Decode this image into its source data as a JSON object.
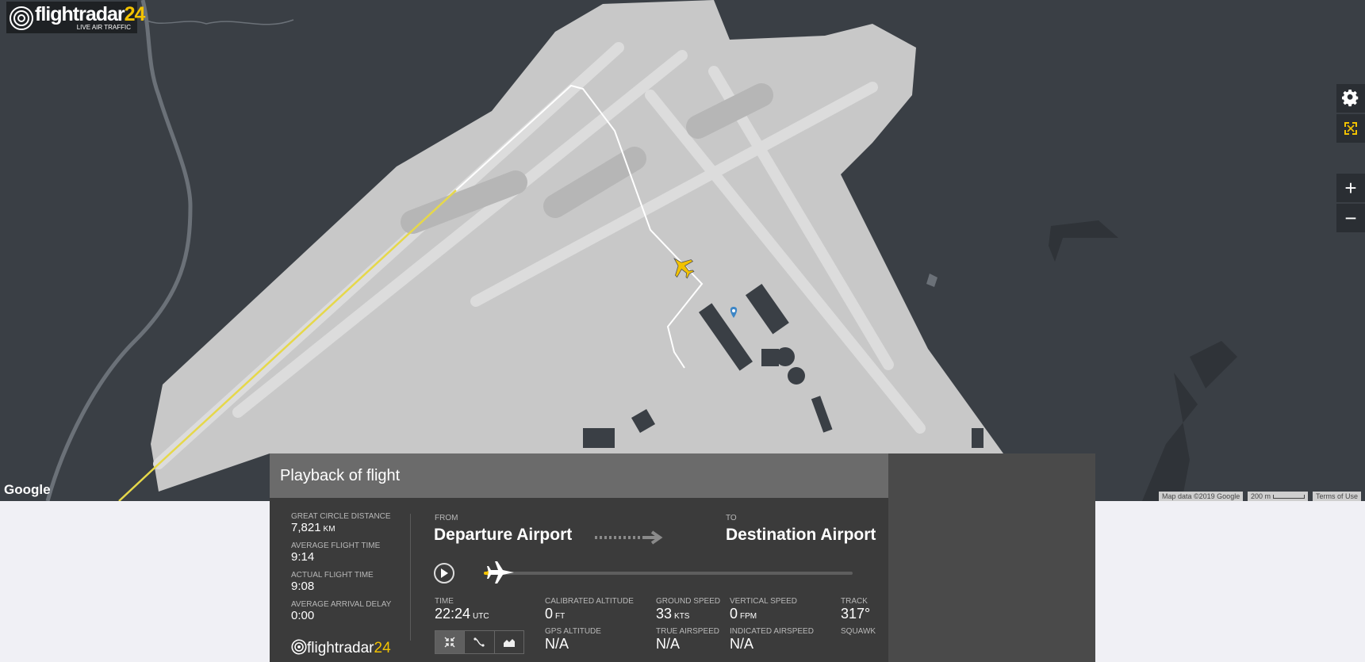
{
  "app": {
    "logo_name": "flightradar",
    "logo_num": "24",
    "tagline": "LIVE AIR TRAFFIC"
  },
  "map": {
    "provider_logo": "Google",
    "attribution": "Map data ©2019 Google",
    "scale": "200 m",
    "terms": "Terms of Use",
    "controls": {
      "settings_icon": "gear-icon",
      "fullscreen_icon": "fullscreen-icon",
      "zoom_in": "+",
      "zoom_out": "−"
    }
  },
  "panel": {
    "title": "Playback of flight",
    "stats": [
      {
        "label": "GREAT CIRCLE DISTANCE",
        "value": "7,821",
        "unit": "KM"
      },
      {
        "label": "AVERAGE FLIGHT TIME",
        "value": "9:14",
        "unit": ""
      },
      {
        "label": "ACTUAL FLIGHT TIME",
        "value": "9:08",
        "unit": ""
      },
      {
        "label": "AVERAGE ARRIVAL DELAY",
        "value": "0:00",
        "unit": ""
      }
    ],
    "from_label": "FROM",
    "from": "Departure Airport",
    "to_label": "TO",
    "to": "Destination Airport",
    "playback_progress": 0.01,
    "time": {
      "label": "TIME",
      "value": "22:24",
      "unit": "UTC"
    },
    "calibrated_altitude": {
      "label": "CALIBRATED ALTITUDE",
      "value": "0",
      "unit": "FT"
    },
    "ground_speed": {
      "label": "GROUND SPEED",
      "value": "33",
      "unit": "KTS"
    },
    "vertical_speed": {
      "label": "VERTICAL SPEED",
      "value": "0",
      "unit": "FPM"
    },
    "track": {
      "label": "TRACK",
      "value": "317°"
    },
    "gps_altitude": {
      "label": "GPS ALTITUDE",
      "value": "N/A"
    },
    "true_airspeed": {
      "label": "TRUE AIRSPEED",
      "value": "N/A"
    },
    "indicated_airspeed": {
      "label": "INDICATED AIRSPEED",
      "value": "N/A"
    },
    "squawk": {
      "label": "SQUAWK",
      "value": ""
    },
    "footer_logo_name": "flightradar",
    "footer_logo_num": "24"
  },
  "colors": {
    "map_bg": "#3a3f45",
    "airport": "#c8c8c8",
    "accent": "#f2c200",
    "panel": "#3b3b3b"
  }
}
